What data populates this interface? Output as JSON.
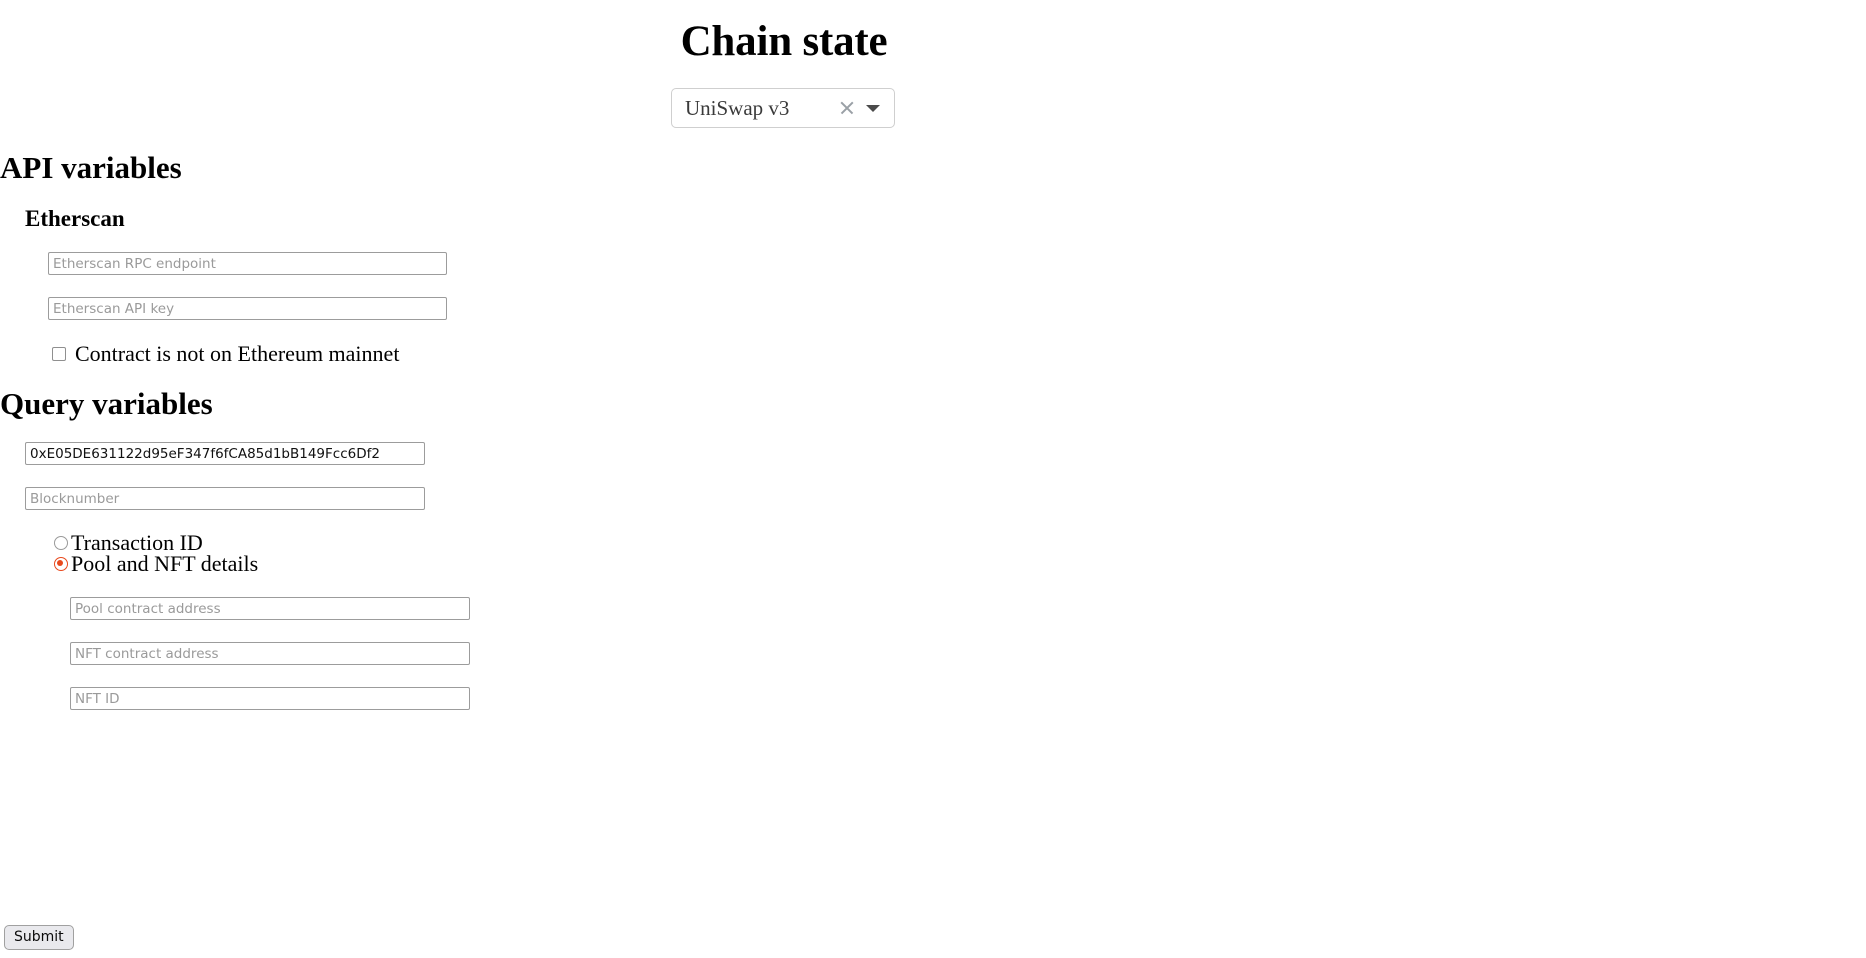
{
  "header": {
    "title": "Chain state"
  },
  "protocol_select": {
    "value": "UniSwap v3",
    "clear_icon": "close-icon",
    "caret_icon": "chevron-down-icon"
  },
  "api_variables": {
    "heading": "API variables",
    "etherscan": {
      "heading": "Etherscan",
      "fields": [
        {
          "name": "etherscan-rpc-endpoint",
          "placeholder": "Etherscan RPC endpoint",
          "value": ""
        },
        {
          "name": "etherscan-api-key",
          "placeholder": "Etherscan API key",
          "value": ""
        }
      ],
      "checkbox": {
        "label": "Contract is not on Ethereum mainnet",
        "checked": false
      }
    }
  },
  "query_variables": {
    "heading": "Query variables",
    "fields": [
      {
        "name": "contract-address",
        "placeholder": "",
        "value": "0xE05DE631122d95eF347f6fCA85d1bB149Fcc6Df2"
      },
      {
        "name": "blocknumber",
        "placeholder": "Blocknumber",
        "value": ""
      }
    ],
    "query_mode": {
      "options": [
        {
          "label": "Transaction ID",
          "selected": false
        },
        {
          "label": "Pool and NFT details",
          "selected": true
        }
      ]
    },
    "detail_fields": [
      {
        "name": "pool-contract-address",
        "placeholder": "Pool contract address",
        "value": ""
      },
      {
        "name": "nft-contract-address",
        "placeholder": "NFT contract address",
        "value": ""
      },
      {
        "name": "nft-id",
        "placeholder": "NFT ID",
        "value": ""
      }
    ]
  },
  "submit": {
    "label": "Submit"
  },
  "colors": {
    "accent": "#e8491d",
    "input_border": "#9c9c9c",
    "placeholder": "#9a9a9a",
    "select_border": "#cfcfcf"
  }
}
